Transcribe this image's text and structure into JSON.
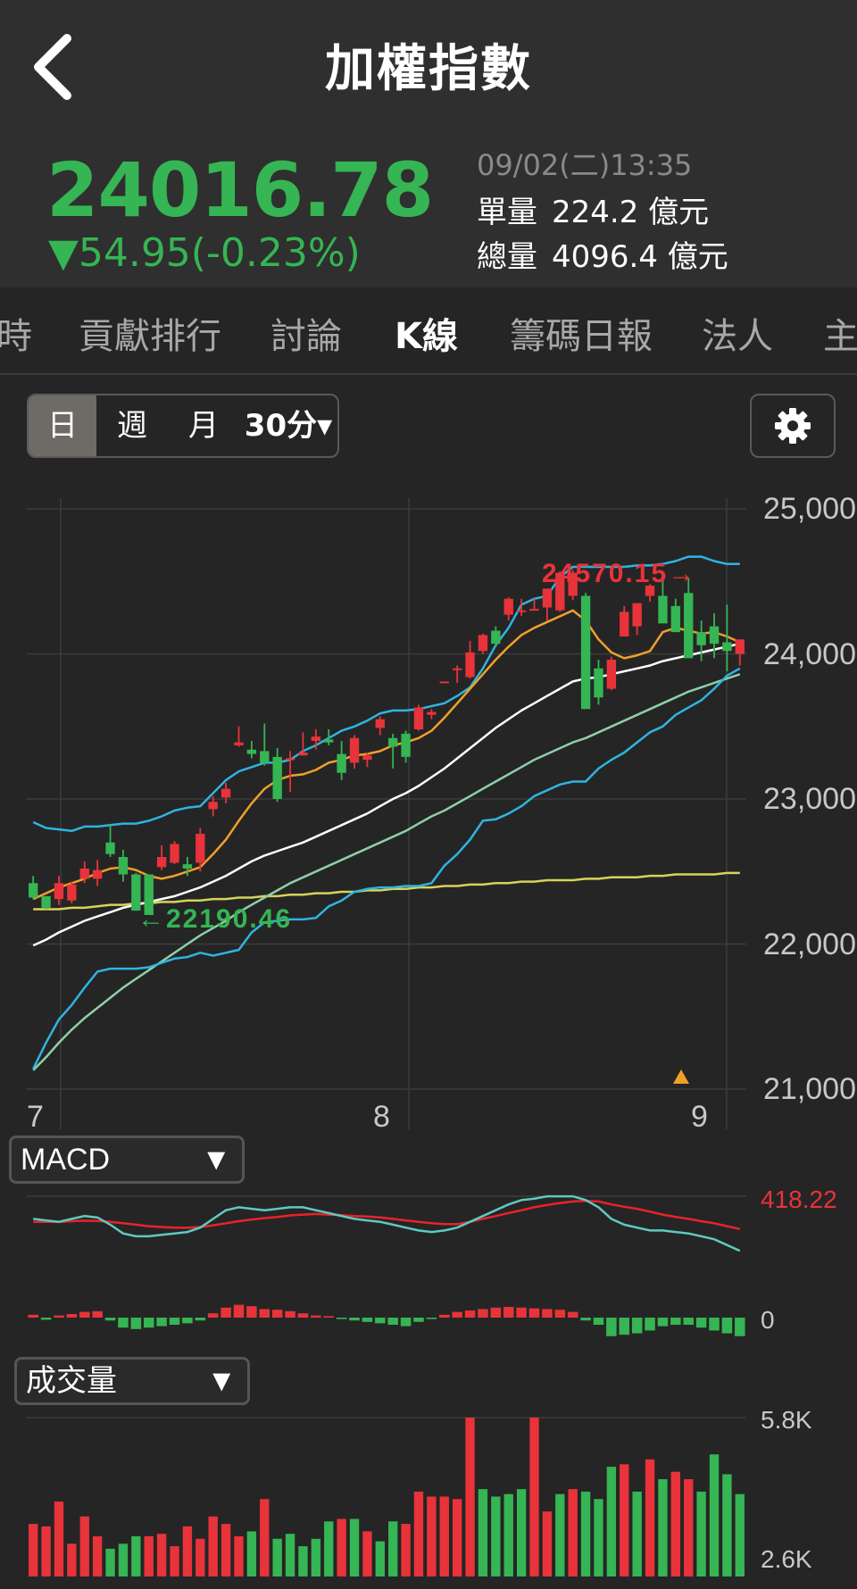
{
  "header": {
    "title": "加權指數",
    "price": "24016.78",
    "change": "▼54.95(-0.23%)",
    "datetime": "09/02(二)13:35",
    "single_label": "單量",
    "single_value": "224.2 億元",
    "total_label": "總量",
    "total_value": "4096.4 億元"
  },
  "tabs": [
    "時",
    "貢獻排行",
    "討論",
    "K線",
    "籌碼日報",
    "法人",
    "主"
  ],
  "active_tab": "K線",
  "period": {
    "options": [
      "日",
      "週",
      "月",
      "30分▾"
    ],
    "selected": "日"
  },
  "icons": {
    "back": "chevron-left-icon",
    "settings": "gear-icon"
  },
  "colors": {
    "up": "#e8333a",
    "down": "#35b553",
    "bg": "#252525",
    "ma5": "#f0a02a",
    "ma20": "#ffffff",
    "ma60": "#8fcfa8",
    "ma240": "#d6d35a",
    "bb": "#2fb4e0",
    "alert": "#f0a02a"
  },
  "chart_data": [
    {
      "type": "candlestick",
      "name": "price",
      "y_ticks": [
        "25,000",
        "24,000",
        "23,000",
        "22,000",
        "21,000"
      ],
      "ylim": [
        21000,
        25000
      ],
      "x_labels": [
        "7",
        "8",
        "9"
      ],
      "annotations": {
        "high": "24570.15→",
        "low": "←22190.46"
      },
      "candles": [
        [
          22420,
          22470,
          22310,
          22320
        ],
        [
          22330,
          22320,
          22240,
          22250
        ],
        [
          22310,
          22470,
          22270,
          22420
        ],
        [
          22300,
          22430,
          22280,
          22410
        ],
        [
          22450,
          22570,
          22420,
          22520
        ],
        [
          22450,
          22580,
          22400,
          22510
        ],
        [
          22700,
          22820,
          22600,
          22620
        ],
        [
          22600,
          22650,
          22430,
          22480
        ],
        [
          22480,
          22490,
          22230,
          22230
        ],
        [
          22480,
          22480,
          22200,
          22200
        ],
        [
          22530,
          22680,
          22510,
          22600
        ],
        [
          22560,
          22710,
          22550,
          22690
        ],
        [
          22550,
          22600,
          22470,
          22520
        ],
        [
          22560,
          22800,
          22500,
          22760
        ],
        [
          22930,
          23020,
          22880,
          22980
        ],
        [
          23010,
          23110,
          22970,
          23070
        ],
        [
          23370,
          23500,
          23360,
          23390
        ],
        [
          23340,
          23400,
          23280,
          23310
        ],
        [
          23330,
          23520,
          23230,
          23250
        ],
        [
          23290,
          23350,
          22980,
          23000
        ],
        [
          23270,
          23330,
          23050,
          23280
        ],
        [
          23300,
          23460,
          23300,
          23320
        ],
        [
          23400,
          23480,
          23340,
          23430
        ],
        [
          23410,
          23480,
          23370,
          23390
        ],
        [
          23310,
          23400,
          23130,
          23180
        ],
        [
          23250,
          23440,
          23210,
          23420
        ],
        [
          23270,
          23320,
          23220,
          23300
        ],
        [
          23490,
          23570,
          23440,
          23550
        ],
        [
          23420,
          23450,
          23210,
          23360
        ],
        [
          23450,
          23470,
          23250,
          23290
        ],
        [
          23480,
          23650,
          23470,
          23630
        ],
        [
          23580,
          23620,
          23550,
          23600
        ],
        [
          23810,
          23810,
          23810,
          23810
        ],
        [
          23900,
          23920,
          23800,
          23900
        ],
        [
          23840,
          24090,
          23830,
          24010
        ],
        [
          24020,
          24140,
          24000,
          24130
        ],
        [
          24160,
          24190,
          24050,
          24070
        ],
        [
          24270,
          24390,
          24230,
          24380
        ],
        [
          24300,
          24380,
          24260,
          24300
        ],
        [
          24310,
          24380,
          24300,
          24310
        ],
        [
          24320,
          24450,
          24230,
          24450
        ],
        [
          24300,
          24570,
          24290,
          24560
        ],
        [
          24400,
          24580,
          24370,
          24560
        ],
        [
          24400,
          24420,
          23620,
          23620
        ],
        [
          23900,
          23960,
          23650,
          23700
        ],
        [
          23760,
          23980,
          23750,
          23960
        ],
        [
          24120,
          24330,
          24120,
          24290
        ],
        [
          24190,
          24300,
          24130,
          24350
        ],
        [
          24400,
          24480,
          24360,
          24470
        ],
        [
          24400,
          24530,
          24300,
          24210
        ],
        [
          24330,
          24380,
          24220,
          24150
        ],
        [
          24420,
          24520,
          23990,
          23970
        ],
        [
          24150,
          24230,
          23950,
          24060
        ],
        [
          24190,
          24280,
          23970,
          24070
        ],
        [
          24080,
          24340,
          23880,
          24020
        ],
        [
          24000,
          24020,
          23920,
          24100
        ]
      ],
      "ma5": [
        22310,
        22350,
        22390,
        22420,
        22450,
        22490,
        22520,
        22530,
        22510,
        22470,
        22450,
        22470,
        22500,
        22530,
        22620,
        22720,
        22850,
        22970,
        23070,
        23130,
        23160,
        23170,
        23200,
        23250,
        23270,
        23300,
        23310,
        23330,
        23370,
        23390,
        23420,
        23470,
        23560,
        23660,
        23760,
        23860,
        23960,
        24050,
        24130,
        24180,
        24220,
        24260,
        24300,
        24230,
        24100,
        24010,
        23970,
        23990,
        24020,
        24150,
        24180,
        24160,
        24140,
        24150,
        24120,
        24080
      ],
      "ma20": [
        21990,
        22030,
        22080,
        22120,
        22160,
        22190,
        22220,
        22250,
        22270,
        22290,
        22310,
        22330,
        22360,
        22390,
        22430,
        22470,
        22520,
        22570,
        22610,
        22640,
        22670,
        22700,
        22740,
        22780,
        22820,
        22860,
        22900,
        22950,
        23000,
        23040,
        23090,
        23150,
        23210,
        23280,
        23350,
        23420,
        23490,
        23550,
        23610,
        23660,
        23710,
        23760,
        23810,
        23830,
        23840,
        23860,
        23880,
        23900,
        23920,
        23950,
        23970,
        23990,
        24010,
        24030,
        24050,
        24070
      ],
      "ma60": [
        21130,
        21220,
        21320,
        21410,
        21490,
        21560,
        21630,
        21700,
        21760,
        21820,
        21880,
        21940,
        22000,
        22060,
        22110,
        22160,
        22220,
        22270,
        22320,
        22370,
        22420,
        22460,
        22500,
        22540,
        22580,
        22620,
        22660,
        22700,
        22740,
        22780,
        22830,
        22880,
        22920,
        22970,
        23020,
        23070,
        23120,
        23170,
        23220,
        23270,
        23310,
        23350,
        23390,
        23420,
        23460,
        23500,
        23540,
        23580,
        23620,
        23660,
        23700,
        23740,
        23770,
        23800,
        23830,
        23860
      ],
      "ma240": [
        22240,
        22240,
        22240,
        22250,
        22250,
        22260,
        22270,
        22270,
        22280,
        22280,
        22290,
        22290,
        22300,
        22300,
        22310,
        22310,
        22320,
        22320,
        22330,
        22330,
        22340,
        22340,
        22350,
        22350,
        22360,
        22360,
        22370,
        22370,
        22380,
        22380,
        22390,
        22390,
        22400,
        22400,
        22410,
        22410,
        22420,
        22420,
        22430,
        22430,
        22440,
        22440,
        22440,
        22450,
        22450,
        22460,
        22460,
        22460,
        22470,
        22470,
        22480,
        22480,
        22480,
        22480,
        22490,
        22490
      ],
      "bb_upper": [
        22840,
        22800,
        22790,
        22780,
        22810,
        22810,
        22820,
        22830,
        22830,
        22850,
        22880,
        22920,
        22940,
        22950,
        23040,
        23130,
        23190,
        23220,
        23250,
        23250,
        23270,
        23330,
        23370,
        23420,
        23470,
        23500,
        23540,
        23590,
        23610,
        23610,
        23620,
        23640,
        23660,
        23710,
        23770,
        23900,
        24060,
        24180,
        24340,
        24380,
        24400,
        24530,
        24600,
        24600,
        24600,
        24600,
        24600,
        24610,
        24610,
        24620,
        24640,
        24670,
        24670,
        24640,
        24620,
        24620
      ],
      "bb_lower": [
        21140,
        21320,
        21480,
        21580,
        21700,
        21810,
        21830,
        21830,
        21830,
        21840,
        21870,
        21900,
        21910,
        21940,
        21920,
        21940,
        21960,
        22080,
        22150,
        22160,
        22170,
        22170,
        22180,
        22260,
        22300,
        22360,
        22380,
        22390,
        22390,
        22400,
        22400,
        22420,
        22540,
        22620,
        22720,
        22850,
        22860,
        22900,
        22950,
        23020,
        23060,
        23100,
        23120,
        23120,
        23210,
        23270,
        23320,
        23390,
        23460,
        23500,
        23580,
        23630,
        23680,
        23760,
        23850,
        23900
      ]
    },
    {
      "type": "line",
      "name": "MACD",
      "selector": "MACD",
      "y_ticks": [
        "418.22",
        "0"
      ],
      "dif": [
        340,
        335,
        330,
        340,
        350,
        345,
        320,
        290,
        280,
        280,
        285,
        290,
        295,
        310,
        340,
        370,
        380,
        375,
        370,
        375,
        380,
        380,
        370,
        360,
        350,
        340,
        335,
        330,
        320,
        310,
        300,
        295,
        300,
        310,
        330,
        350,
        370,
        390,
        405,
        410,
        418,
        418,
        418,
        405,
        380,
        340,
        320,
        310,
        300,
        300,
        295,
        290,
        280,
        270,
        250,
        230
      ],
      "dea": [
        330,
        330,
        330,
        332,
        334,
        333,
        330,
        325,
        320,
        315,
        312,
        310,
        310,
        312,
        318,
        325,
        332,
        338,
        343,
        347,
        352,
        355,
        357,
        355,
        353,
        350,
        348,
        345,
        340,
        335,
        330,
        325,
        322,
        322,
        330,
        340,
        350,
        360,
        370,
        380,
        388,
        395,
        400,
        402,
        400,
        390,
        382,
        375,
        365,
        355,
        347,
        340,
        332,
        325,
        315,
        305
      ],
      "histogram": [
        4,
        -3,
        3,
        5,
        8,
        9,
        -4,
        -14,
        -16,
        -14,
        -12,
        -10,
        -8,
        -4,
        6,
        14,
        18,
        16,
        12,
        11,
        9,
        6,
        3,
        2,
        -2,
        -4,
        -6,
        -8,
        -10,
        -12,
        -6,
        -2,
        4,
        8,
        10,
        12,
        14,
        15,
        14,
        13,
        12,
        11,
        8,
        -4,
        -10,
        -26,
        -24,
        -22,
        -18,
        -12,
        -10,
        -10,
        -14,
        -18,
        -22,
        -26
      ]
    },
    {
      "type": "bar",
      "name": "volume",
      "selector": "成交量",
      "y_ticks": [
        "5.8K",
        "2.6K"
      ],
      "values": [
        3300,
        3250,
        3750,
        2900,
        3450,
        3050,
        2800,
        2900,
        3050,
        3050,
        3100,
        2850,
        3250,
        3000,
        3450,
        3300,
        3050,
        3150,
        3800,
        3000,
        3100,
        2850,
        3000,
        3350,
        3400,
        3400,
        3150,
        2950,
        3350,
        3300,
        3950,
        3850,
        3850,
        3800,
        5800,
        4000,
        3850,
        3900,
        4000,
        5800,
        3550,
        3900,
        4000,
        3950,
        3800,
        4450,
        4500,
        3950,
        4600,
        4200,
        4350,
        4200,
        3950,
        4700,
        4300,
        3900
      ],
      "directions": [
        "up",
        "up",
        "up",
        "up",
        "up",
        "up",
        "down",
        "down",
        "down",
        "up",
        "up",
        "up",
        "up",
        "up",
        "up",
        "up",
        "up",
        "down",
        "up",
        "down",
        "down",
        "down",
        "down",
        "down",
        "up",
        "down",
        "up",
        "down",
        "down",
        "up",
        "up",
        "up",
        "up",
        "up",
        "up",
        "down",
        "down",
        "down",
        "down",
        "up",
        "up",
        "down",
        "up",
        "down",
        "down",
        "down",
        "up",
        "down",
        "up",
        "down",
        "up",
        "up",
        "down",
        "down",
        "down",
        "down"
      ]
    }
  ]
}
